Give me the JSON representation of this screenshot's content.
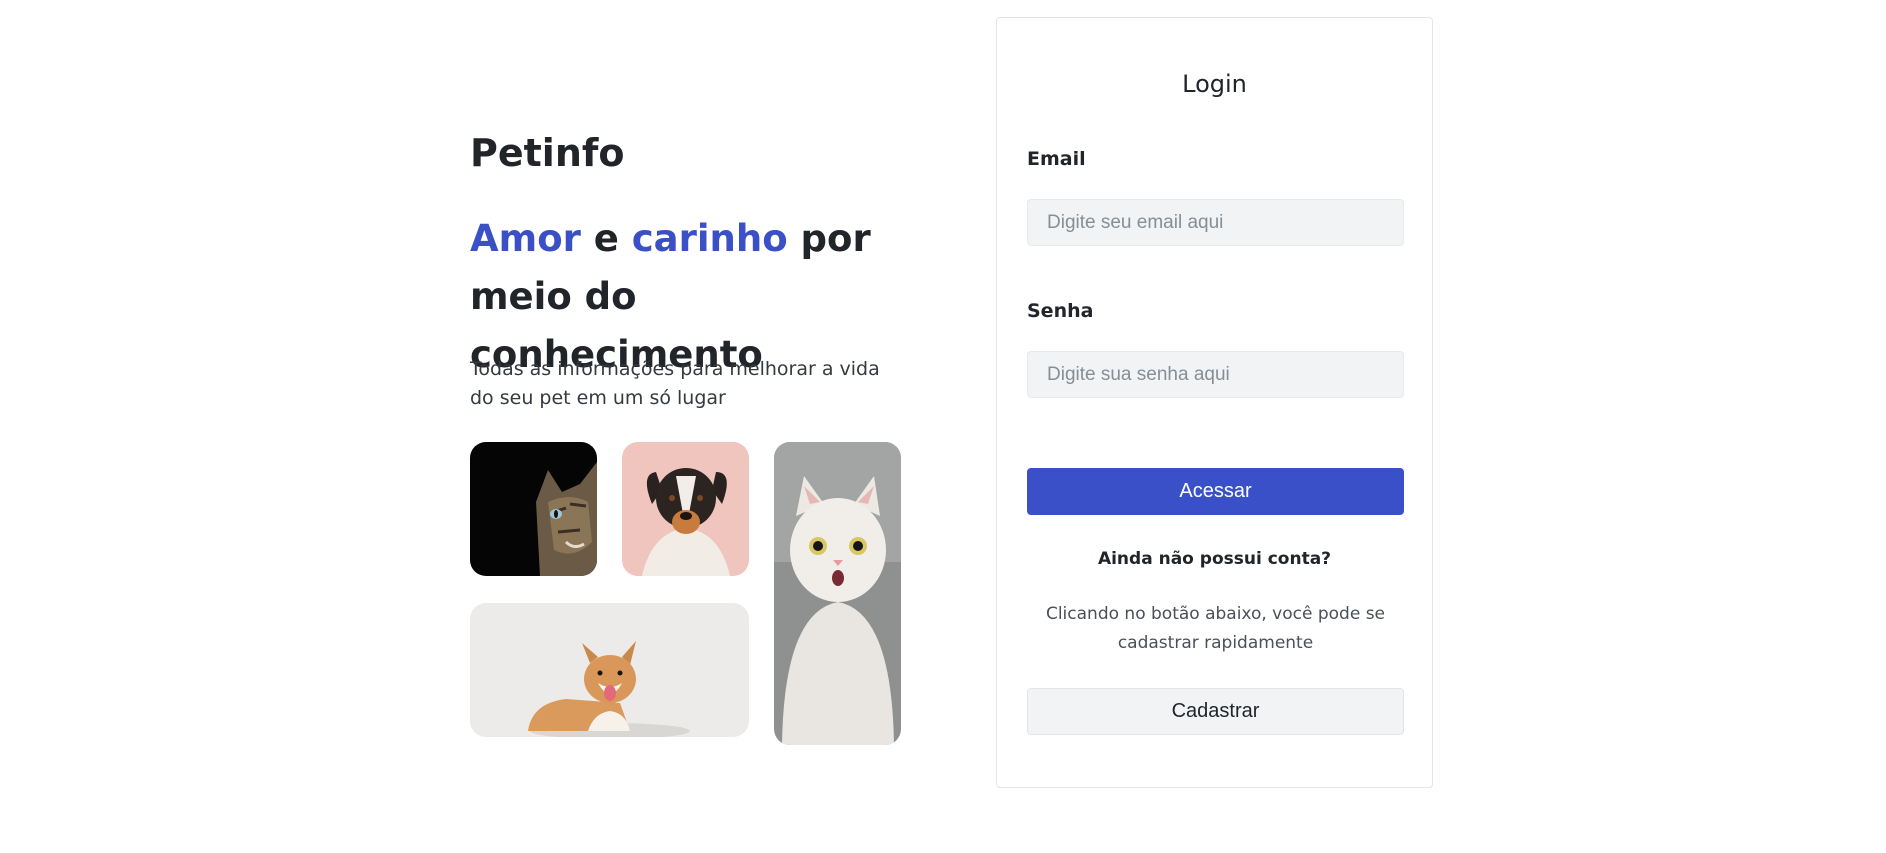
{
  "intro": {
    "brand": "Petinfo",
    "headline": {
      "word1": "Amor",
      "word2": " e ",
      "word3": "carinho",
      "rest": " por meio do conhecimento"
    },
    "subtitle": "Todas as informações para melhorar a vida do seu pet em um só lugar"
  },
  "colors": {
    "accent": "#3b4fc6",
    "primary_button": "#3a50c9",
    "input_background": "#f1f3f5"
  },
  "login": {
    "title": "Login",
    "email_label": "Email",
    "email_placeholder": "Digite seu email aqui",
    "email_value": "",
    "password_label": "Senha",
    "password_placeholder": "Digite sua senha aqui",
    "password_value": "",
    "submit_label": "Acessar",
    "no_account_text": "Ainda não possui conta?",
    "register_hint": "Clicando no botão abaixo, você pode se cadastrar rapidamente",
    "register_label": "Cadastrar"
  }
}
